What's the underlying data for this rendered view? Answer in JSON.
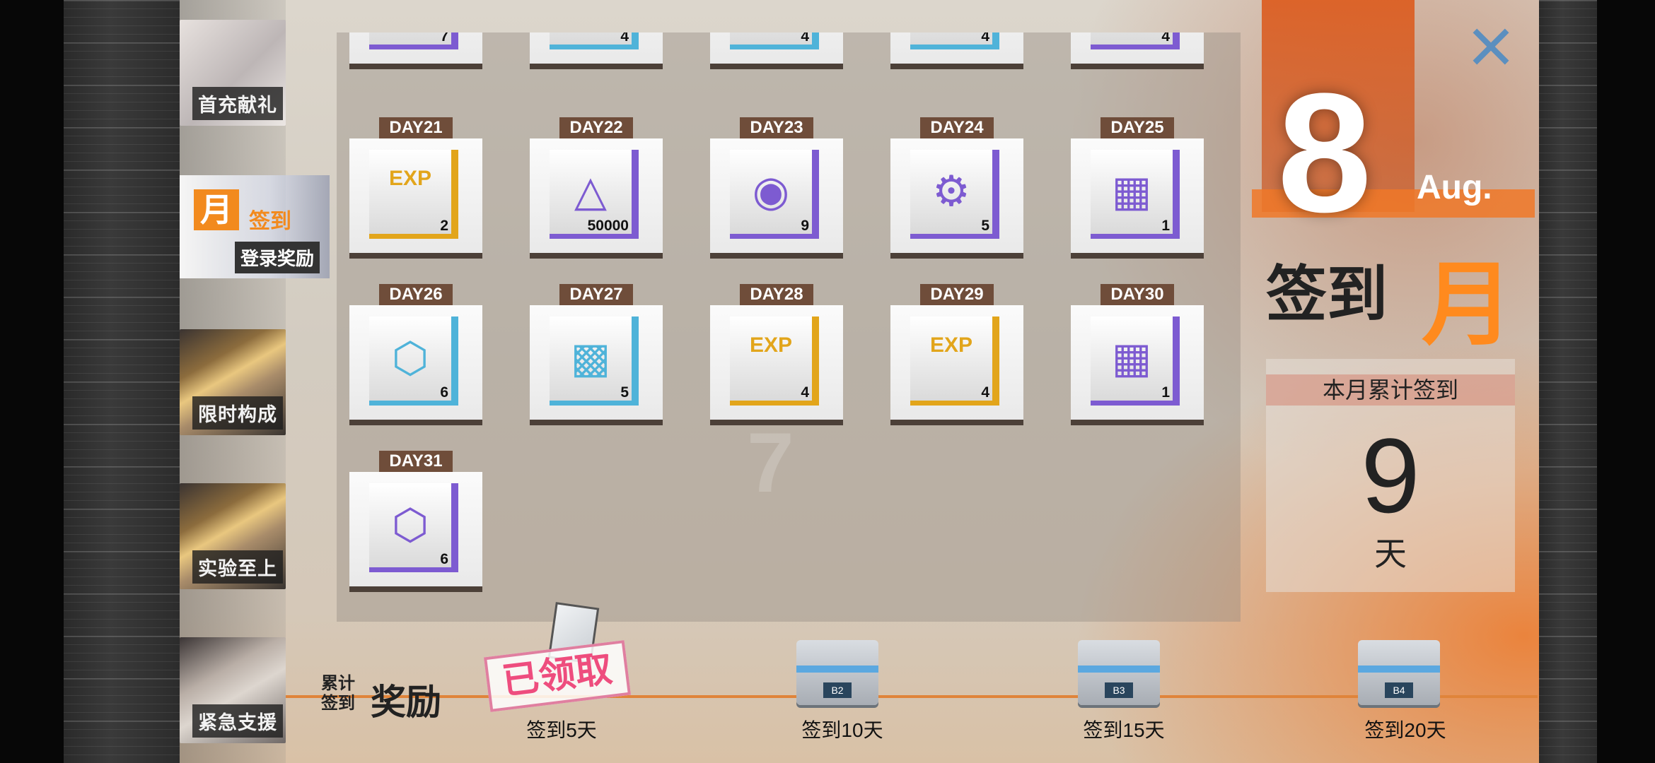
{
  "nav": [
    "首充献礼",
    "限时构成",
    "实验至上",
    "紧急支援"
  ],
  "nav_active": {
    "month_char": "月",
    "title": "签到",
    "subtitle": "登录奖励"
  },
  "month": {
    "number": "8",
    "name": "Aug.",
    "checkin": "签到",
    "month_char": "月"
  },
  "accumulated": {
    "title": "本月累计签到",
    "count": "9",
    "unit": "天"
  },
  "rewards_top": [
    {
      "qty": "7",
      "icon": "eye-icon",
      "rarity": "purple"
    },
    {
      "qty": "4",
      "icon": "wrench-icon",
      "rarity": "blue"
    },
    {
      "qty": "4",
      "icon": "hex-token-icon",
      "rarity": "blue"
    },
    {
      "qty": "4",
      "icon": "crystal-icon",
      "rarity": "blue"
    },
    {
      "qty": "4",
      "icon": "cube-icon",
      "rarity": "purple"
    }
  ],
  "rewards": [
    {
      "day": "DAY21",
      "qty": "2",
      "icon": "exp-capsule-icon",
      "rarity": "gold"
    },
    {
      "day": "DAY22",
      "qty": "50000",
      "icon": "coin-triangle-icon",
      "rarity": "purple"
    },
    {
      "day": "DAY23",
      "qty": "9",
      "icon": "eye-icon",
      "rarity": "purple"
    },
    {
      "day": "DAY24",
      "qty": "5",
      "icon": "wrench-icon",
      "rarity": "purple"
    },
    {
      "day": "DAY25",
      "qty": "1",
      "icon": "cube-icon",
      "rarity": "purple"
    },
    {
      "day": "DAY26",
      "qty": "6",
      "icon": "hex-token-icon",
      "rarity": "blue"
    },
    {
      "day": "DAY27",
      "qty": "5",
      "icon": "grid-chip-icon",
      "rarity": "blue"
    },
    {
      "day": "DAY28",
      "qty": "4",
      "icon": "exp-capsule-icon",
      "rarity": "gold"
    },
    {
      "day": "DAY29",
      "qty": "4",
      "icon": "exp-capsule-icon",
      "rarity": "gold"
    },
    {
      "day": "DAY30",
      "qty": "1",
      "icon": "cube-icon",
      "rarity": "purple"
    },
    {
      "day": "DAY31",
      "qty": "6",
      "icon": "hex-token-icon",
      "rarity": "purple"
    }
  ],
  "rarity_colors": {
    "purple": "#7d5bd1",
    "blue": "#4fb3d9",
    "gold": "#e2a51b"
  },
  "cumulative": {
    "small1": "累计",
    "small2": "签到",
    "large": "奖励",
    "claimed": "已领取"
  },
  "chests": [
    "B2",
    "B3",
    "B4"
  ],
  "milestones": [
    "签到5天",
    "签到10天",
    "签到15天",
    "签到20天"
  ]
}
